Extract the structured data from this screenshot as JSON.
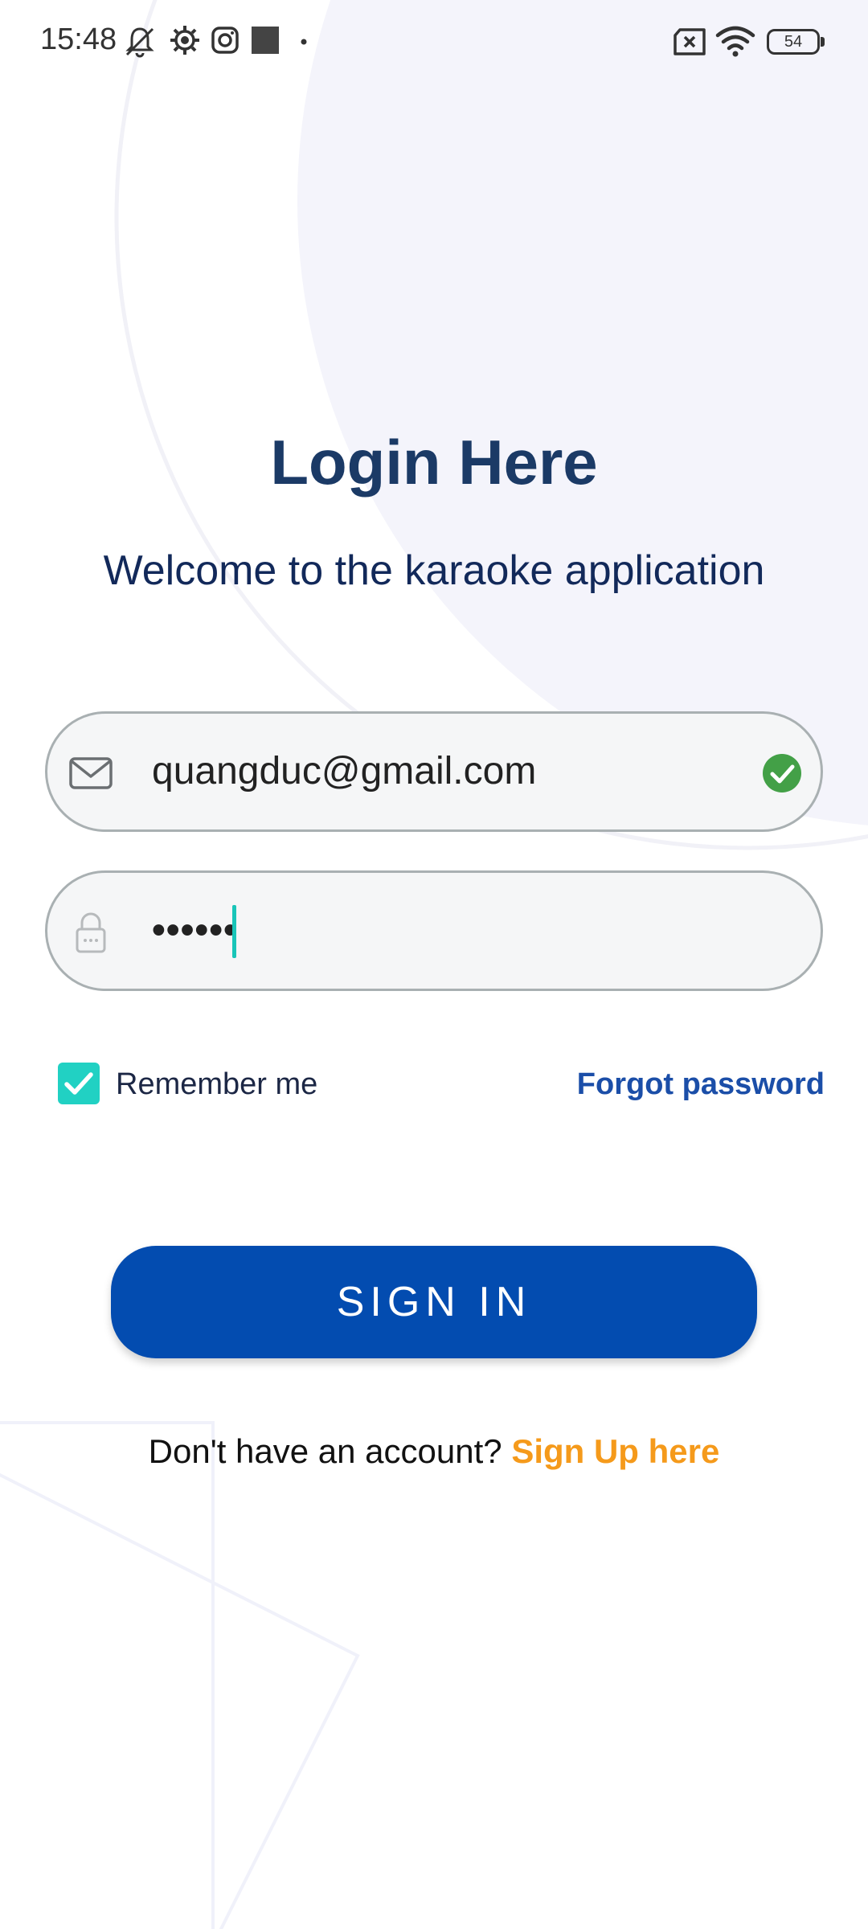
{
  "status_bar": {
    "time": "15:48",
    "battery": "54",
    "left_icons": [
      "bell-muted-icon",
      "settings-icon",
      "instagram-icon",
      "square-icon",
      "dot-icon"
    ],
    "right_icons": [
      "sim-x-icon",
      "wifi-icon",
      "battery-icon"
    ]
  },
  "login": {
    "title": "Login Here",
    "subtitle": "Welcome to the karaoke application",
    "email_value": "quangduc@gmail.com",
    "password_value": "••••••",
    "remember_label": "Remember me",
    "remember_checked": true,
    "forgot_label": "Forgot password",
    "signin_label": "SIGN IN",
    "signup_prompt": "Don't have an account?",
    "signup_link": "Sign Up here"
  },
  "colors": {
    "title": "#1b3a66",
    "primary_button": "#034cb0",
    "accent_teal": "#21d1c3",
    "link_orange": "#f59a1b",
    "valid_green": "#43a047"
  }
}
